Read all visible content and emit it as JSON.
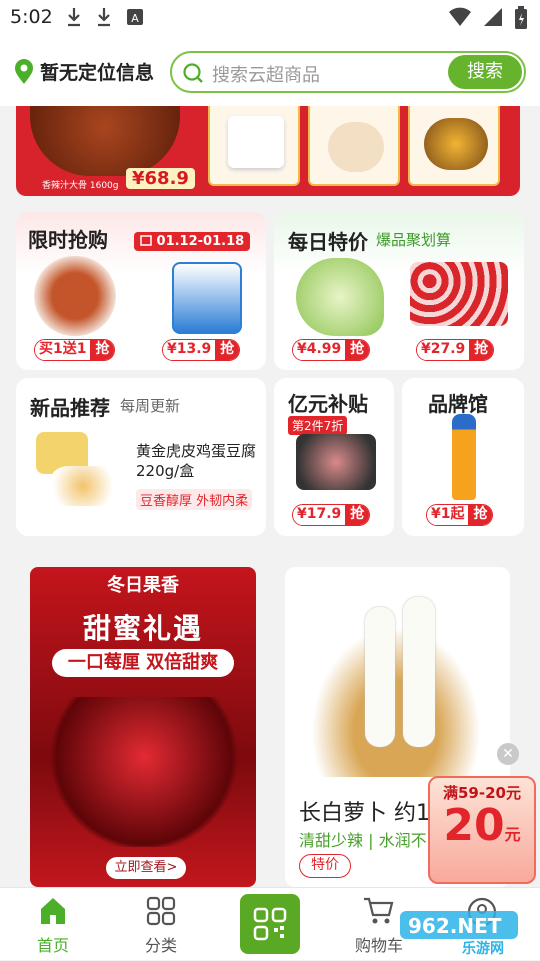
{
  "status": {
    "time": "5:02"
  },
  "header": {
    "location": "暂无定位信息",
    "search_placeholder": "搜索云超商品",
    "search_button": "搜索"
  },
  "banner": {
    "price": "68.9",
    "small_text": "香辣汁大骨 1600g"
  },
  "flash": {
    "title": "限时抢购",
    "dates": "01.12-01.18",
    "items": [
      {
        "label": "买1送1",
        "cta": "抢"
      },
      {
        "label": "¥13.9",
        "cta": "抢"
      }
    ]
  },
  "daily": {
    "title": "每日特价",
    "subtitle": "爆品聚划算",
    "items": [
      {
        "label": "¥4.99",
        "cta": "抢"
      },
      {
        "label": "¥27.9",
        "cta": "抢"
      }
    ]
  },
  "newp": {
    "title": "新品推荐",
    "subtitle": "每周更新",
    "product": "黄金虎皮鸡蛋豆腐",
    "weight": "220g/盒",
    "badge": "豆香醇厚 外韧内柔"
  },
  "yiyuan": {
    "title": "亿元补贴",
    "badge": "第2件7折",
    "price": "¥17.9",
    "cta": "抢"
  },
  "brand": {
    "title": "品牌馆",
    "price": "¥1起",
    "cta": "抢"
  },
  "promo": {
    "top": "冬日果香",
    "title": "甜蜜礼遇",
    "subtitle": "一口莓厘 双倍甜爽",
    "button": "立即查看>"
  },
  "radish": {
    "name": "长白萝卜 约1",
    "desc": "清甜少辣 | 水润不",
    "tag": "特价"
  },
  "coupon": {
    "title": "满59-20元",
    "amount": "20",
    "unit": "元"
  },
  "tabs": [
    {
      "label": "首页"
    },
    {
      "label": "分类"
    },
    {
      "label": "购物车"
    }
  ],
  "watermark": "962.NET 乐游网",
  "colors": {
    "accent": "#66b32e",
    "red": "#e2252b"
  }
}
